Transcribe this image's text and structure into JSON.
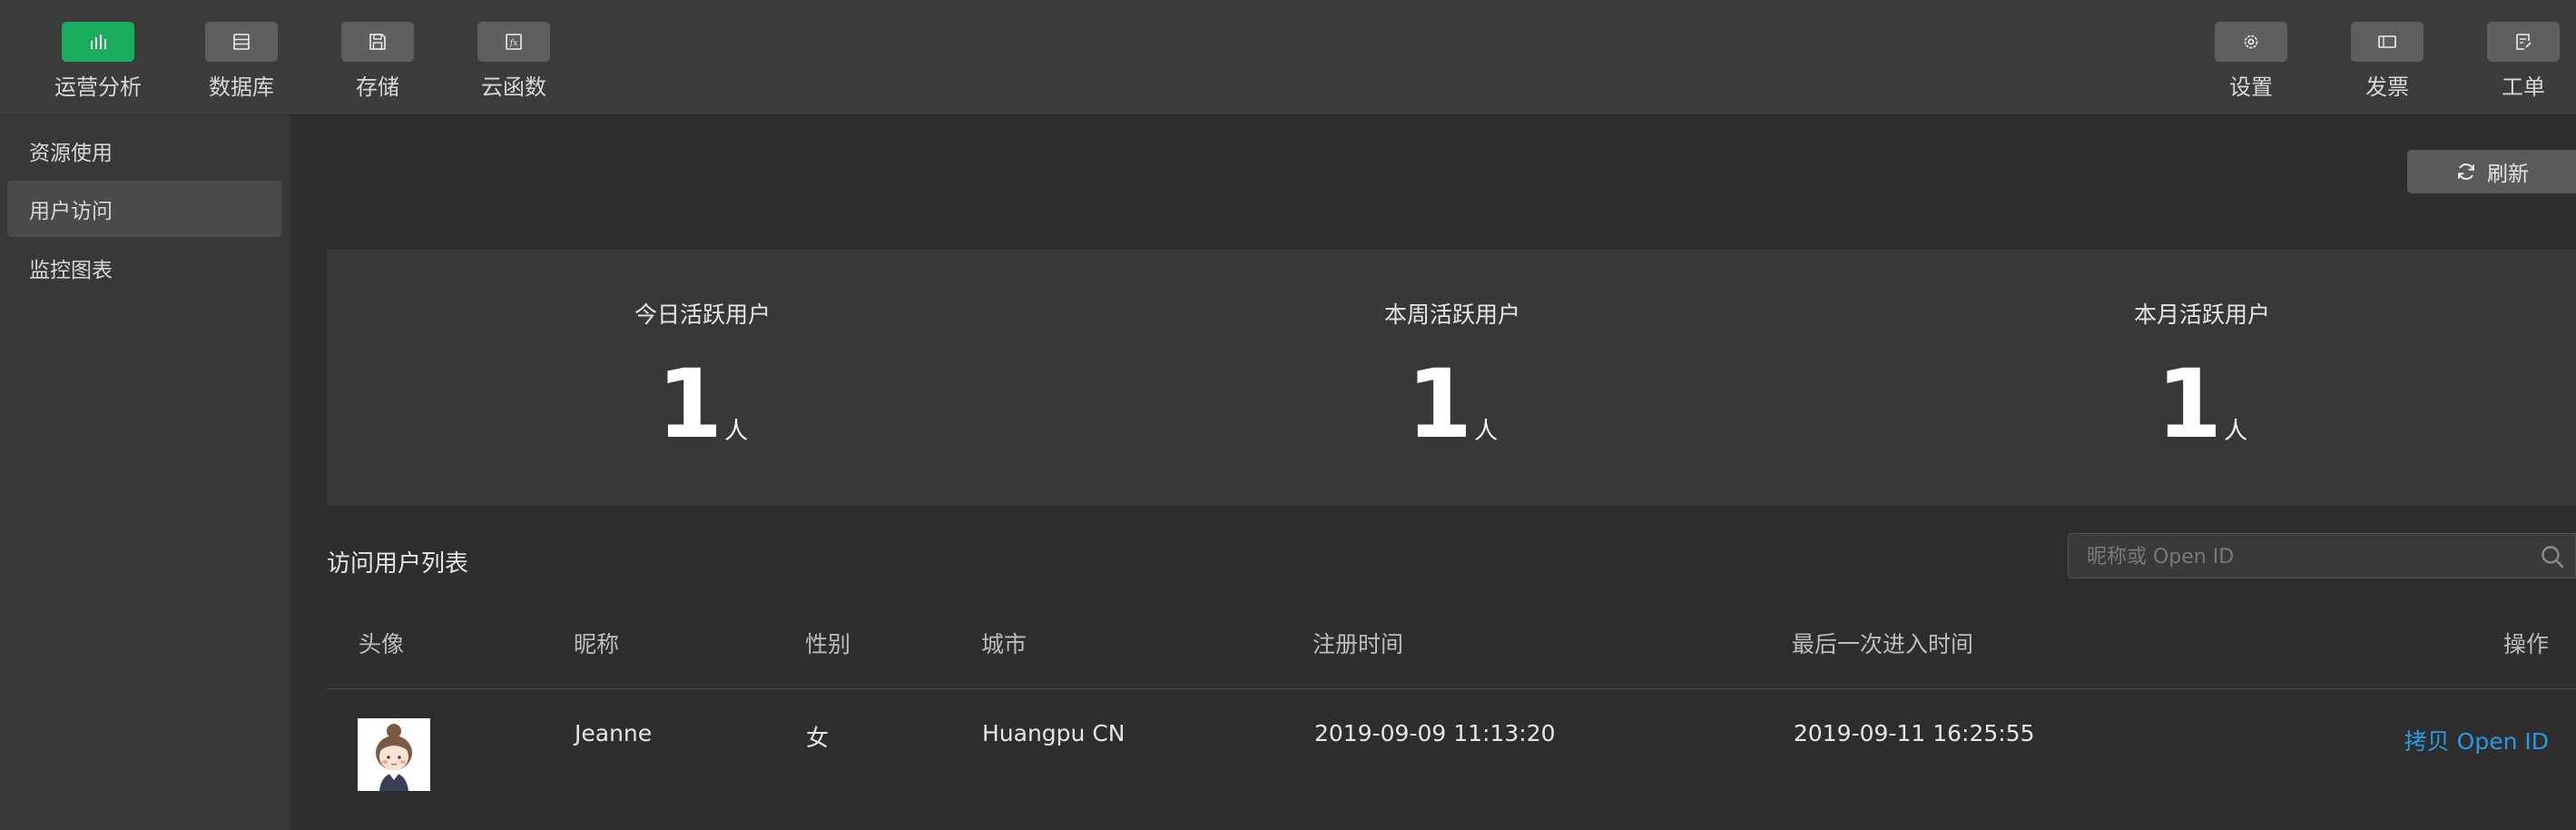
{
  "toolbar": {
    "left": [
      {
        "label": "运营分析",
        "icon": "bar-chart-icon",
        "active": true
      },
      {
        "label": "数据库",
        "icon": "database-icon",
        "active": false
      },
      {
        "label": "存储",
        "icon": "save-icon",
        "active": false
      },
      {
        "label": "云函数",
        "icon": "function-icon",
        "active": false
      }
    ],
    "right": [
      {
        "label": "设置",
        "icon": "gear-icon"
      },
      {
        "label": "发票",
        "icon": "invoice-icon"
      },
      {
        "label": "工单",
        "icon": "ticket-icon"
      }
    ]
  },
  "sidebar": {
    "items": [
      {
        "label": "资源使用",
        "active": false
      },
      {
        "label": "用户访问",
        "active": true
      },
      {
        "label": "监控图表",
        "active": false
      }
    ]
  },
  "refresh": {
    "label": "刷新",
    "icon": "refresh-icon"
  },
  "stats": [
    {
      "title": "今日活跃用户",
      "value": "1",
      "unit": "人"
    },
    {
      "title": "本周活跃用户",
      "value": "1",
      "unit": "人"
    },
    {
      "title": "本月活跃用户",
      "value": "1",
      "unit": "人"
    }
  ],
  "list": {
    "title": "访问用户列表",
    "search_placeholder": "昵称或 Open ID",
    "columns": [
      "头像",
      "昵称",
      "性别",
      "城市",
      "注册时间",
      "最后一次进入时间",
      "操作"
    ],
    "rows": [
      {
        "nickname": "Jeanne",
        "gender": "女",
        "city": "Huangpu CN",
        "registered": "2019-09-09 11:13:20",
        "last_visit": "2019-09-11 16:25:55",
        "action": "拷贝 Open ID"
      }
    ]
  },
  "colors": {
    "accent_green": "#1aad5f",
    "link_blue": "#2a9ae0",
    "background": "#2e2e2e",
    "panel": "#383838"
  }
}
